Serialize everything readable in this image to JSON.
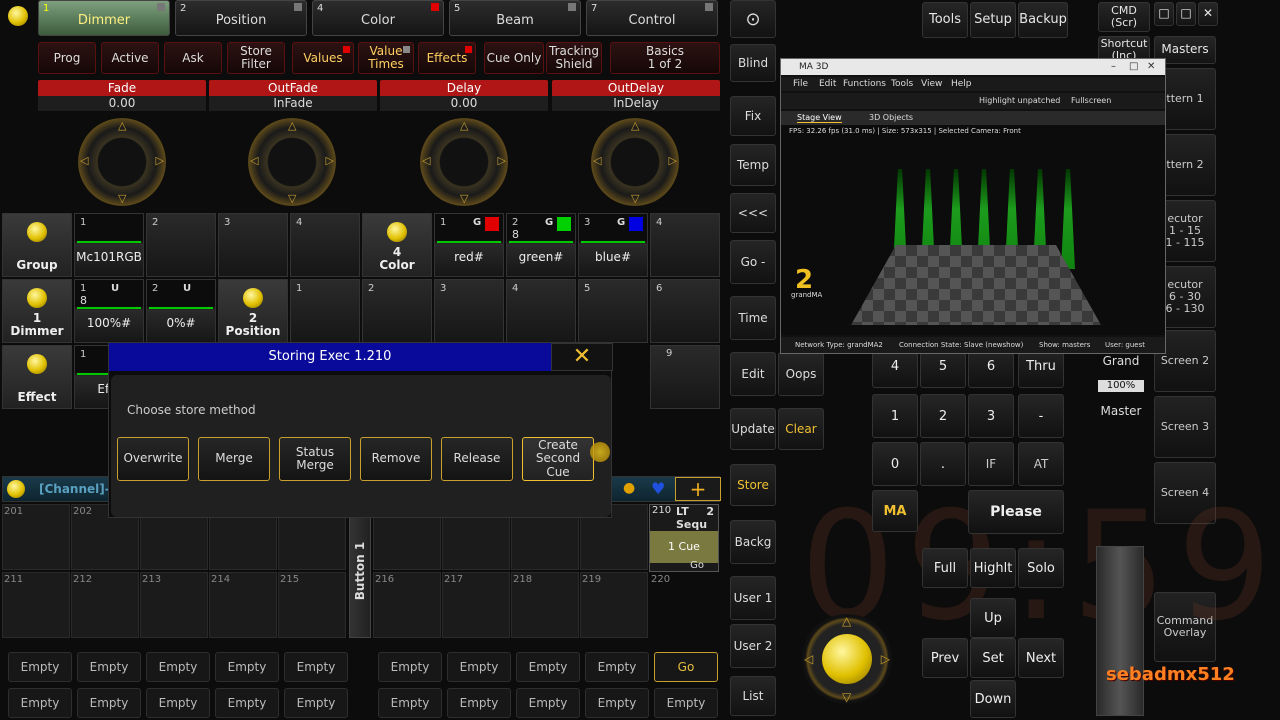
{
  "presets": [
    {
      "num": "1",
      "label": "Dimmer"
    },
    {
      "num": "2",
      "label": "Position"
    },
    {
      "num": "4",
      "label": "Color"
    },
    {
      "num": "5",
      "label": "Beam"
    },
    {
      "num": "7",
      "label": "Control"
    }
  ],
  "modes": [
    "Prog",
    "Active",
    "Ask",
    "Store\nFilter",
    "Values",
    "Value\nTimes",
    "Effects",
    "Cue Only",
    "Tracking\nShield",
    "Basics\n1 of 2"
  ],
  "encoders": [
    {
      "label": "Fade",
      "value": "0.00"
    },
    {
      "label": "OutFade",
      "value": "InFade"
    },
    {
      "label": "Delay",
      "value": "0.00"
    },
    {
      "label": "OutDelay",
      "value": "InDelay"
    }
  ],
  "pool": {
    "row1": [
      {
        "title": "Group"
      },
      {
        "num": "1",
        "label": "Mc101RGB"
      },
      {
        "num": "2"
      },
      {
        "num": "3"
      },
      {
        "num": "4"
      },
      {
        "title": "4\nColor"
      },
      {
        "num": "1",
        "g": "G",
        "label": "red#",
        "color": "#e00000"
      },
      {
        "num": "2",
        "g": "G",
        "label": "green#",
        "color": "#00d000",
        "sub": "8"
      },
      {
        "num": "3",
        "g": "G",
        "label": "blue#",
        "color": "#0000e0"
      },
      {
        "num": "4"
      }
    ],
    "row2": [
      {
        "title": "1\nDimmer"
      },
      {
        "num": "1",
        "u": "U",
        "label": "100%#",
        "sub": "8"
      },
      {
        "num": "2",
        "u": "U",
        "label": "0%#"
      },
      {
        "title": "2\nPosition"
      },
      {
        "num": "1"
      },
      {
        "num": "2"
      },
      {
        "num": "3"
      },
      {
        "num": "4"
      },
      {
        "num": "5"
      },
      {
        "num": "6"
      }
    ],
    "row3": [
      {
        "title": "Effect"
      },
      {
        "num": "1",
        "label": "Effe"
      },
      {
        "num": "9"
      }
    ]
  },
  "dialog": {
    "title": "Storing Exec 1.210",
    "prompt": "Choose store method",
    "buttons": [
      "Overwrite",
      "Merge",
      "Status\nMerge",
      "Remove",
      "Release",
      "Create\nSecond Cue"
    ]
  },
  "channel_bar": "[Channel]-S",
  "exec_numbers": [
    "201",
    "202",
    "211",
    "212",
    "213",
    "214",
    "215",
    "216",
    "217",
    "218",
    "219",
    "220"
  ],
  "button1": "Button 1",
  "seq": {
    "num": "210",
    "title": "LT Sequ",
    "num2": "2",
    "cue": "1 Cue",
    "go": "Go"
  },
  "empty_label": "Empty",
  "go_label": "Go",
  "side": [
    "Blind",
    "Fix",
    "Temp",
    "<<<",
    "Go -",
    "Time",
    "Edit",
    "Update",
    "Store",
    "Backg",
    "User 1",
    "User 2",
    "List"
  ],
  "oops": "Oops",
  "clear": "Clear",
  "top_right": [
    "Tools",
    "Setup",
    "Backup"
  ],
  "cmd": "CMD\n(Scr)",
  "shortcut": "Shortcut\n(Inc)",
  "masters": "Masters",
  "right_col": [
    "ttern 1",
    "ttern 2",
    "ecutor\n1 - 15\n1 - 115",
    "ecutor\n6 - 30\n6 - 130",
    "Screen 2",
    "Screen 3",
    "Screen 4",
    "Command\nOverlay"
  ],
  "keypad": [
    "4",
    "5",
    "6",
    "Thru",
    "1",
    "2",
    "3",
    "-",
    "0",
    ".",
    "IF",
    "AT"
  ],
  "please": "Please",
  "grand": {
    "label": "Grand",
    "value": "100%",
    "sub": "Master"
  },
  "bottom_keys": [
    "Full",
    "Highlt",
    "Solo",
    "Up",
    "Prev",
    "Set",
    "Next",
    "Down"
  ],
  "clock": "09:59",
  "ma3d": {
    "title": "MA 3D",
    "menu": [
      "File",
      "Edit",
      "Functions",
      "Tools",
      "View",
      "Help"
    ],
    "toolbar": [
      "Highlight unpatched",
      "Fullscreen"
    ],
    "tabs": [
      "Stage View",
      "3D Objects"
    ],
    "status": "FPS: 32.26 fps (31.0 ms) | Size: 573x315 | Selected Camera: Front",
    "footer": [
      "Network Type: grandMA2",
      "Connection State: Slave (newshow)",
      "Show: masters",
      "User: guest"
    ],
    "logo": "grandMA"
  },
  "watermark": "sebadmx512"
}
